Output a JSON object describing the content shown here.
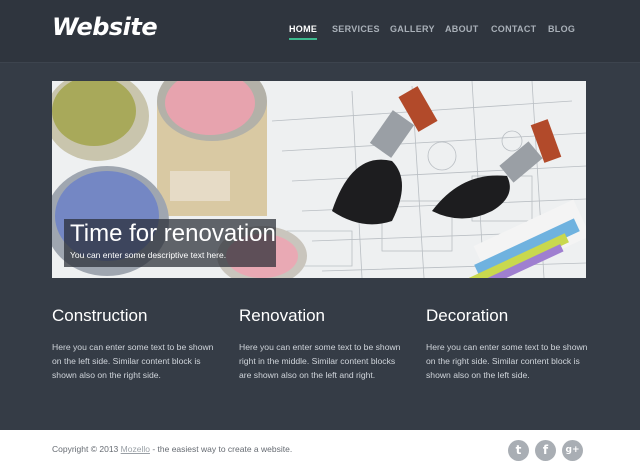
{
  "header": {
    "logo": "Website",
    "nav": [
      {
        "label": "HOME",
        "active": true
      },
      {
        "label": "SERVICES",
        "active": false
      },
      {
        "label": "GALLERY",
        "active": false
      },
      {
        "label": "ABOUT",
        "active": false
      },
      {
        "label": "CONTACT",
        "active": false
      },
      {
        "label": "BLOG",
        "active": false
      }
    ]
  },
  "hero": {
    "title": "Time for renovation",
    "text": "You can enter some descriptive text here."
  },
  "columns": [
    {
      "heading": "Construction",
      "text": "Here you can enter some text to be shown on the left side. Similar content block is shown also on the right side."
    },
    {
      "heading": "Renovation",
      "text": "Here you can enter some text to be shown right in the middle. Similar content blocks are shown also on the left and right."
    },
    {
      "heading": "Decoration",
      "text": "Here you can enter some text to be shown on the right side. Similar content block is shown also on the left side."
    }
  ],
  "footer": {
    "copyright_prefix": "Copyright © 2013",
    "link_text": "Mozello",
    "copyright_suffix": "- the easiest way to create a website.",
    "social": [
      {
        "icon": "twitter-icon",
        "glyph": "t"
      },
      {
        "icon": "facebook-icon",
        "glyph": "f"
      },
      {
        "icon": "google-plus-icon",
        "glyph": "g+"
      }
    ]
  },
  "colors": {
    "background": "#353c46",
    "header": "#2f353e",
    "accent": "#3dbb8f",
    "footer": "#ffffff"
  }
}
